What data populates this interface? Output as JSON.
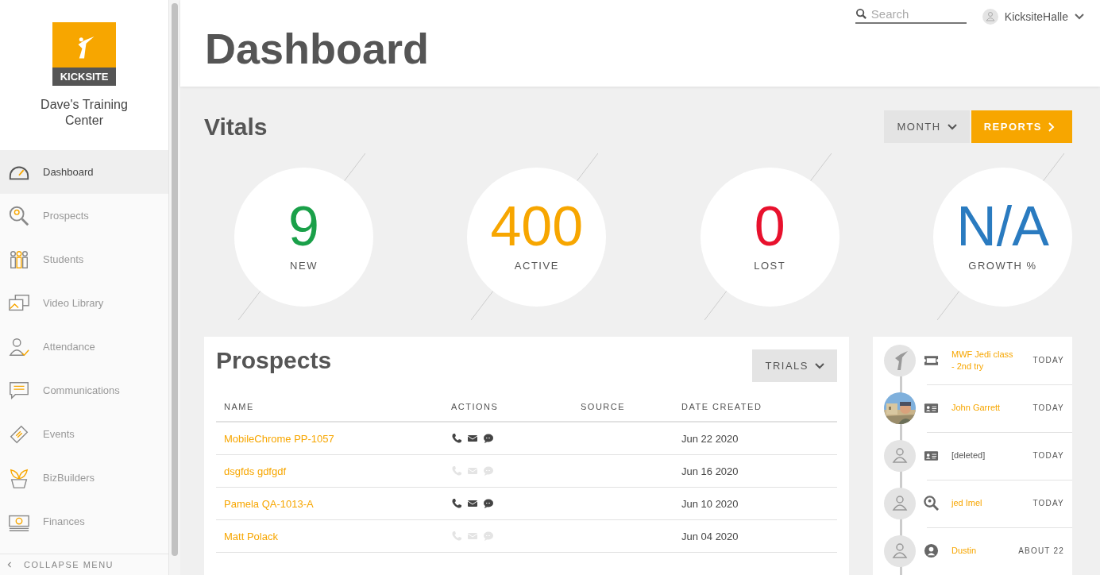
{
  "sidebar": {
    "logo_text": "KICKSITE",
    "school_name": "Dave's Training Center",
    "items": [
      {
        "label": "Dashboard",
        "selected": true
      },
      {
        "label": "Prospects",
        "selected": false
      },
      {
        "label": "Students",
        "selected": false
      },
      {
        "label": "Video Library",
        "selected": false
      },
      {
        "label": "Attendance",
        "selected": false
      },
      {
        "label": "Communications",
        "selected": false
      },
      {
        "label": "Events",
        "selected": false
      },
      {
        "label": "BizBuilders",
        "selected": false
      },
      {
        "label": "Finances",
        "selected": false
      }
    ],
    "collapse": "COLLAPSE MENU"
  },
  "header": {
    "title": "Dashboard",
    "search": {
      "placeholder": "Search"
    },
    "user": "KicksiteHalle"
  },
  "vitals": {
    "title": "Vitals",
    "period": "MONTH",
    "reports": "REPORTS",
    "items": [
      {
        "value": "9",
        "label": "NEW",
        "color": "#1aa049"
      },
      {
        "value": "400",
        "label": "ACTIVE",
        "color": "#f7a600"
      },
      {
        "value": "0",
        "label": "LOST",
        "color": "#e8112d"
      },
      {
        "value": "N/A",
        "label": "GROWTH %",
        "color": "#2a7bc0"
      }
    ]
  },
  "prospects": {
    "title": "Prospects",
    "filter": "TRIALS",
    "columns": [
      "NAME",
      "ACTIONS",
      "SOURCE",
      "DATE CREATED"
    ],
    "rows": [
      {
        "name": "MobileChrome PP-1057",
        "actions_enabled": true,
        "date": "Jun 22 2020"
      },
      {
        "name": "dsgfds gdfgdf",
        "actions_enabled": false,
        "date": "Jun 16 2020"
      },
      {
        "name": "Pamela QA-1013-A",
        "actions_enabled": true,
        "date": "Jun 10 2020"
      },
      {
        "name": "Matt Polack",
        "actions_enabled": false,
        "date": "Jun 04 2020"
      }
    ]
  },
  "activity": [
    {
      "text": "MWF Jedi class - 2nd try",
      "link": true,
      "time": "TODAY"
    },
    {
      "text": "John Garrett",
      "link": true,
      "time": "TODAY"
    },
    {
      "text": "[deleted]",
      "link": false,
      "time": "TODAY"
    },
    {
      "text": "jed Imel",
      "link": true,
      "time": "TODAY"
    },
    {
      "text": "Dustin",
      "link": true,
      "time": "ABOUT 22"
    }
  ]
}
